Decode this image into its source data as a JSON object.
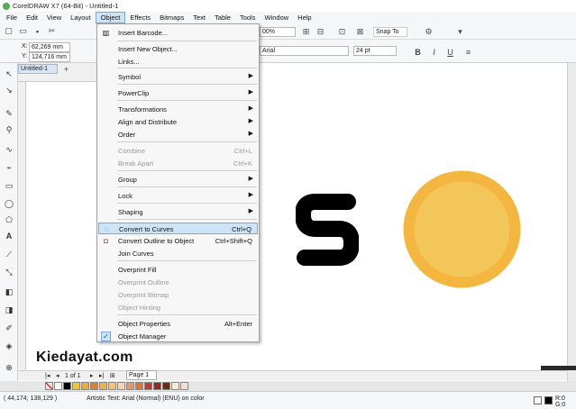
{
  "window": {
    "title": "CorelDRAW X7 (64-Bit) - Untitled-1"
  },
  "menubar": [
    "File",
    "Edit",
    "View",
    "Layout",
    "Object",
    "Effects",
    "Bitmaps",
    "Text",
    "Table",
    "Tools",
    "Window",
    "Help"
  ],
  "toolbar": {
    "zoom": "00%",
    "snap_to": "Snap To",
    "font": "Arial",
    "font_size": "24 pt"
  },
  "position": {
    "x_label": "X:",
    "x_value": "62,269 mm",
    "y_label": "Y:",
    "y_value": "124,716 mm"
  },
  "document_tab": "Untitled-1",
  "object_menu": {
    "items": [
      {
        "label": "Insert Barcode...",
        "shortcut": "",
        "submenu": false,
        "disabled": false,
        "icon": "barcode-icon"
      },
      {
        "label": "Insert New Object...",
        "shortcut": "",
        "submenu": false,
        "disabled": false,
        "icon": ""
      },
      {
        "label": "Links...",
        "shortcut": "",
        "submenu": false,
        "disabled": false,
        "icon": ""
      },
      {
        "label": "Symbol",
        "shortcut": "",
        "submenu": true,
        "disabled": false,
        "icon": ""
      },
      {
        "label": "PowerClip",
        "shortcut": "",
        "submenu": true,
        "disabled": false,
        "icon": ""
      },
      {
        "label": "Transformations",
        "shortcut": "",
        "submenu": true,
        "disabled": false,
        "icon": ""
      },
      {
        "label": "Align and Distribute",
        "shortcut": "",
        "submenu": true,
        "disabled": false,
        "icon": ""
      },
      {
        "label": "Order",
        "shortcut": "",
        "submenu": true,
        "disabled": false,
        "icon": ""
      },
      {
        "label": "Combine",
        "shortcut": "Ctrl+L",
        "submenu": false,
        "disabled": true,
        "icon": ""
      },
      {
        "label": "Break Apart",
        "shortcut": "Ctrl+K",
        "submenu": false,
        "disabled": true,
        "icon": ""
      },
      {
        "label": "Group",
        "shortcut": "",
        "submenu": true,
        "disabled": false,
        "icon": ""
      },
      {
        "label": "Lock",
        "shortcut": "",
        "submenu": true,
        "disabled": false,
        "icon": ""
      },
      {
        "label": "Shaping",
        "shortcut": "",
        "submenu": true,
        "disabled": false,
        "icon": ""
      },
      {
        "label": "Convert to Curves",
        "shortcut": "Ctrl+Q",
        "submenu": false,
        "disabled": false,
        "icon": "convert-curves-icon",
        "highlighted": true
      },
      {
        "label": "Convert Outline to Object",
        "shortcut": "Ctrl+Shift+Q",
        "submenu": false,
        "disabled": false,
        "icon": "convert-outline-icon"
      },
      {
        "label": "Join Curves",
        "shortcut": "",
        "submenu": false,
        "disabled": false,
        "icon": ""
      },
      {
        "label": "Overprint Fill",
        "shortcut": "",
        "submenu": false,
        "disabled": false,
        "icon": ""
      },
      {
        "label": "Overprint Outline",
        "shortcut": "",
        "submenu": false,
        "disabled": true,
        "icon": ""
      },
      {
        "label": "Overprint Bitmap",
        "shortcut": "",
        "submenu": false,
        "disabled": true,
        "icon": ""
      },
      {
        "label": "Object Hinting",
        "shortcut": "",
        "submenu": false,
        "disabled": true,
        "icon": ""
      },
      {
        "label": "Object Properties",
        "shortcut": "Alt+Enter",
        "submenu": false,
        "disabled": false,
        "icon": ""
      },
      {
        "label": "Object Manager",
        "shortcut": "",
        "submenu": false,
        "disabled": false,
        "icon": "check-icon"
      }
    ]
  },
  "canvas": {
    "text_object": "S",
    "coin_outer_color": "#f4b63f",
    "coin_inner_color": "#f3c65a"
  },
  "watermark": "Kiedayat.com",
  "pager": {
    "count": "1 of 1",
    "page_tab": "Page 1"
  },
  "palette": [
    "#ffffff",
    "#000000",
    "#f5c518",
    "#f0a830",
    "#e67e22",
    "#f5b041",
    "#f8c471",
    "#fad7a0",
    "#e59866",
    "#dc7633",
    "#c0392b",
    "#922b21",
    "#6e2c00",
    "#fdebd0",
    "#f6ddcc"
  ],
  "statusbar": {
    "coords": "( 44,174; 138,129 )",
    "info": "Artistic Text: Arial (Normal) (ENU) on color",
    "fill": "R:0 G:0"
  }
}
